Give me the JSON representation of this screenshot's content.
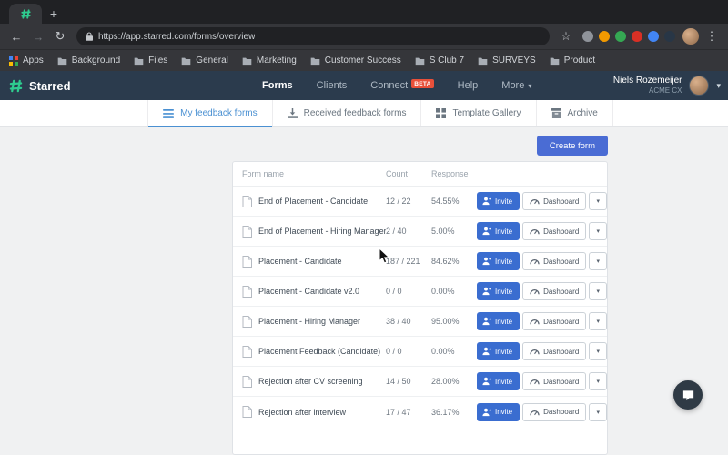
{
  "browser": {
    "url": "https://app.starred.com/forms/overview",
    "new_tab": "+",
    "back": "←",
    "forward": "→",
    "reload": "↻",
    "star": "☆",
    "menu": "⋮",
    "extension_icon_colors": [
      "#8f939a",
      "#f29900",
      "#35a853",
      "#d93025",
      "#4285f4",
      "#283646"
    ],
    "bookmarks": [
      {
        "label": "Apps",
        "icon": "apps-grid-icon"
      },
      {
        "label": "Background",
        "icon": "folder-icon"
      },
      {
        "label": "Files",
        "icon": "folder-icon"
      },
      {
        "label": "General",
        "icon": "folder-icon"
      },
      {
        "label": "Marketing",
        "icon": "folder-icon"
      },
      {
        "label": "Customer Success",
        "icon": "folder-icon"
      },
      {
        "label": "S Club 7",
        "icon": "folder-icon"
      },
      {
        "label": "SURVEYS",
        "icon": "folder-icon"
      },
      {
        "label": "Product",
        "icon": "folder-icon"
      }
    ]
  },
  "app_header": {
    "brand": "Starred",
    "nav": [
      {
        "label": "Forms",
        "active": true
      },
      {
        "label": "Clients"
      },
      {
        "label": "Connect",
        "badge": "BETA"
      },
      {
        "label": "Help"
      },
      {
        "label": "More",
        "chevron": "▾"
      }
    ],
    "user": {
      "name": "Niels Rozemeijer",
      "org": "ACME CX",
      "chevron": "▾"
    }
  },
  "tabs": [
    {
      "label": "My feedback forms",
      "icon": "list-icon",
      "active": true
    },
    {
      "label": "Received feedback forms",
      "icon": "download-icon"
    },
    {
      "label": "Template Gallery",
      "icon": "grid-icon"
    },
    {
      "label": "Archive",
      "icon": "archive-icon"
    }
  ],
  "content": {
    "create_button": "Create form",
    "table": {
      "headers": {
        "name": "Form name",
        "count": "Count",
        "response": "Response"
      },
      "actions": {
        "invite": "Invite",
        "dashboard": "Dashboard",
        "caret": "▾"
      },
      "rows": [
        {
          "name": "End of Placement - Candidate",
          "count": "12 / 22",
          "response": "54.55%"
        },
        {
          "name": "End of Placement - Hiring Manager",
          "count": "2 / 40",
          "response": "5.00%"
        },
        {
          "name": "Placement - Candidate",
          "count": "187 / 221",
          "response": "84.62%"
        },
        {
          "name": "Placement - Candidate v2.0",
          "count": "0 / 0",
          "response": "0.00%"
        },
        {
          "name": "Placement - Hiring Manager",
          "count": "38 / 40",
          "response": "95.00%"
        },
        {
          "name": "Placement Feedback (Candidate)",
          "count": "0 / 0",
          "response": "0.00%"
        },
        {
          "name": "Rejection after CV screening",
          "count": "14 / 50",
          "response": "28.00%"
        },
        {
          "name": "Rejection after interview",
          "count": "17 / 47",
          "response": "36.17%"
        }
      ]
    }
  },
  "colors": {
    "accent_blue": "#3a6dd0",
    "create_blue": "#4a6cd4",
    "header_navy": "#2b3b4d",
    "active_tab_blue": "#4a90d2",
    "beta_red": "#e8503a",
    "brand_green": "#2ecc8f",
    "content_bg": "#f0f1f2"
  }
}
